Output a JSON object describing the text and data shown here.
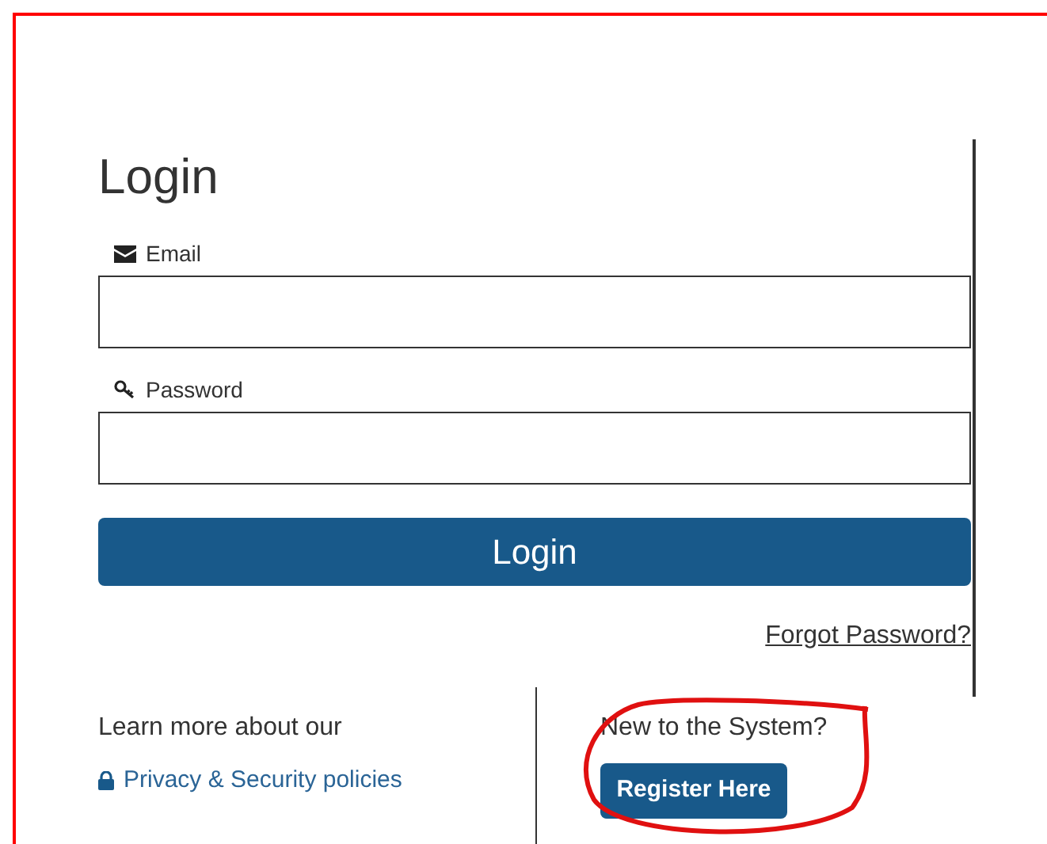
{
  "title": "Login",
  "fields": [
    {
      "kind": "email",
      "label": "Email"
    },
    {
      "kind": "password",
      "label": "Password"
    }
  ],
  "login_button": "Login",
  "forgot_password": "Forgot Password?",
  "info": {
    "text": "Learn more about our",
    "link": "Privacy & Security policies"
  },
  "register": {
    "prompt": "New to the System?",
    "button": "Register Here"
  }
}
